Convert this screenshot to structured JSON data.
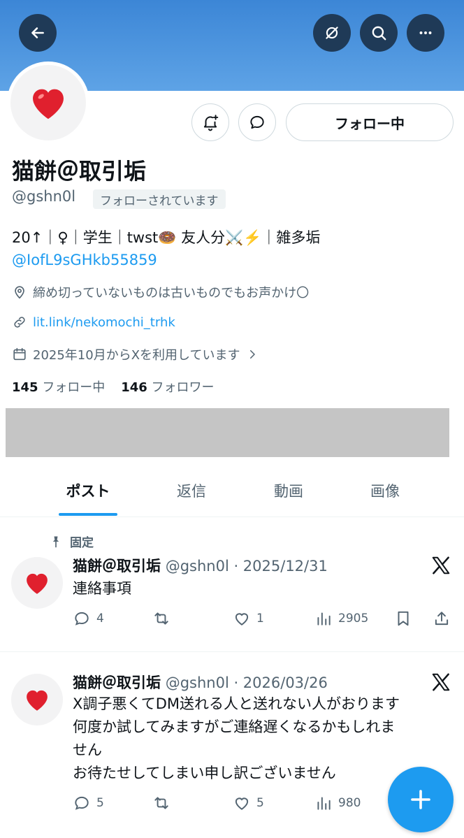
{
  "header": {
    "back_icon": "arrow-left-icon",
    "grok_icon": "grok-icon",
    "search_icon": "search-icon",
    "more_icon": "more-dots-icon"
  },
  "profile": {
    "avatar_emoji": "❤️",
    "follow_button_label": "フォロー中",
    "name": "猫餅＠取引垢",
    "handle": "@gshn0l",
    "follows_you": "フォローされています",
    "bio_line1": "20↑｜♀｜学生｜twst🍩 友人分⚔️⚡️｜雑多垢",
    "bio_link": "@IofL9sGHkb55859",
    "location": "締め切っていないものは古いものでもお声かけ〇",
    "url": "lit.link/nekomochi_trhk",
    "joined": "2025年10月からXを利用しています",
    "following_count": "145",
    "following_label": "フォロー中",
    "followers_count": "146",
    "followers_label": "フォロワー"
  },
  "tabs": [
    {
      "label": "ポスト",
      "active": true
    },
    {
      "label": "返信",
      "active": false
    },
    {
      "label": "動画",
      "active": false
    },
    {
      "label": "画像",
      "active": false
    }
  ],
  "posts": [
    {
      "pinned_label": "固定",
      "avatar_emoji": "❤️",
      "name": "猫餅＠取引垢",
      "meta": "@gshn0l · 2025/12/31",
      "text": "連絡事項",
      "replies": "4",
      "reposts": "",
      "likes": "1",
      "views": "2905"
    },
    {
      "avatar_emoji": "❤️",
      "name": "猫餅＠取引垢",
      "meta": "@gshn0l · 2026/03/26",
      "text_lines": [
        "X調子悪くてDM送れる人と送れない人がおります",
        "何度か試してみますがご連絡遅くなるかもしれま",
        "せん",
        "お待たせしてしまい申し訳ございません"
      ],
      "replies": "5",
      "reposts": "",
      "likes": "5",
      "views": "980"
    }
  ],
  "colors": {
    "banner": "#3c86d6",
    "accent": "#1d9bf0",
    "secondary_text": "#536471"
  }
}
